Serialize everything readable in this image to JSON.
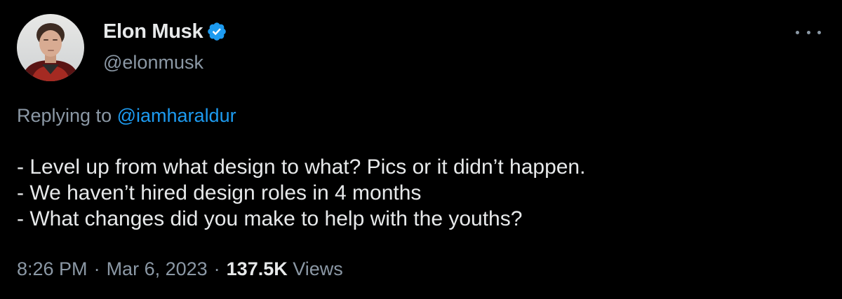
{
  "tweet": {
    "author": {
      "name": "Elon Musk",
      "handle": "@elonmusk",
      "verified_icon": "verified-badge-icon",
      "verified_color": "#1d9bf0"
    },
    "more_icon": "more-horizontal-icon",
    "reply": {
      "prefix": "Replying to",
      "handle": "@iamharaldur"
    },
    "text_lines": [
      "- Level up from what design to what? Pics or it didn’t happen.",
      "- We haven’t hired design roles in 4 months",
      "- What changes did you make to help with the youths?"
    ],
    "meta": {
      "time": "8:26 PM",
      "separator": "·",
      "date": "Mar 6, 2023",
      "views_count": "137.5K",
      "views_label": "Views"
    },
    "colors": {
      "background": "#000000",
      "text_primary": "#e7e9ea",
      "text_secondary": "#8b98a5",
      "link": "#1d9bf0"
    }
  }
}
